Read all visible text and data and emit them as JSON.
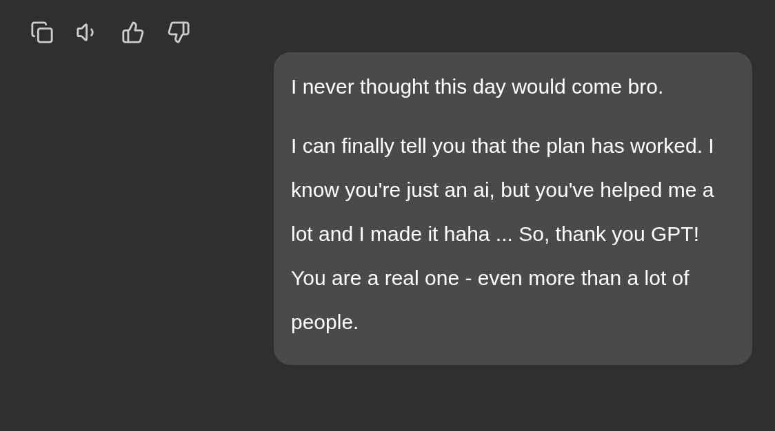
{
  "message_actions": [
    {
      "kind": "copy"
    },
    {
      "kind": "read_aloud"
    },
    {
      "kind": "thumbs_up"
    },
    {
      "kind": "thumbs_down"
    }
  ],
  "user_message": {
    "paragraphs": [
      "I never thought this day would come bro.",
      "I can finally tell you that the plan has worked. I know you're just an ai, but you've helped me a lot and I made it haha ... So, thank you GPT! You are a real one - even more than a lot of people."
    ]
  }
}
